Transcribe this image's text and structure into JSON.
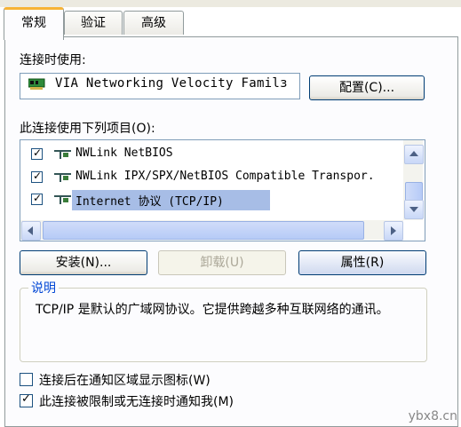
{
  "tabs": [
    {
      "label": "常规",
      "active": true
    },
    {
      "label": "验证",
      "active": false
    },
    {
      "label": "高级",
      "active": false
    }
  ],
  "connect_using_label": "连接时使用:",
  "adapter_name": "VIA Networking Velocity Familз",
  "configure_button": "配置(C)...",
  "components_label": "此连接使用下列项目(O):",
  "components": [
    {
      "label": "NWLink NetBIOS",
      "checked": true,
      "selected": false
    },
    {
      "label": "NWLink IPX/SPX/NetBIOS Compatible Transpor.",
      "checked": true,
      "selected": false
    },
    {
      "label": "Internet 协议 (TCP/IP)",
      "checked": true,
      "selected": true
    }
  ],
  "buttons": {
    "install": "安装(N)...",
    "uninstall": "卸载(U)",
    "properties": "属性(R)"
  },
  "description": {
    "title": "说明",
    "text": "TCP/IP 是默认的广域网协议。它提供跨越多种互联网络的通讯。"
  },
  "options": [
    {
      "label": "连接后在通知区域显示图标(W)",
      "checked": false
    },
    {
      "label": "此连接被限制或无连接时通知我(M)",
      "checked": true
    }
  ],
  "watermark": "ybx8.cn",
  "colors": {
    "tab_accent": "#f7b336",
    "selection": "#a7bde6",
    "link_blue": "#0046d5"
  }
}
